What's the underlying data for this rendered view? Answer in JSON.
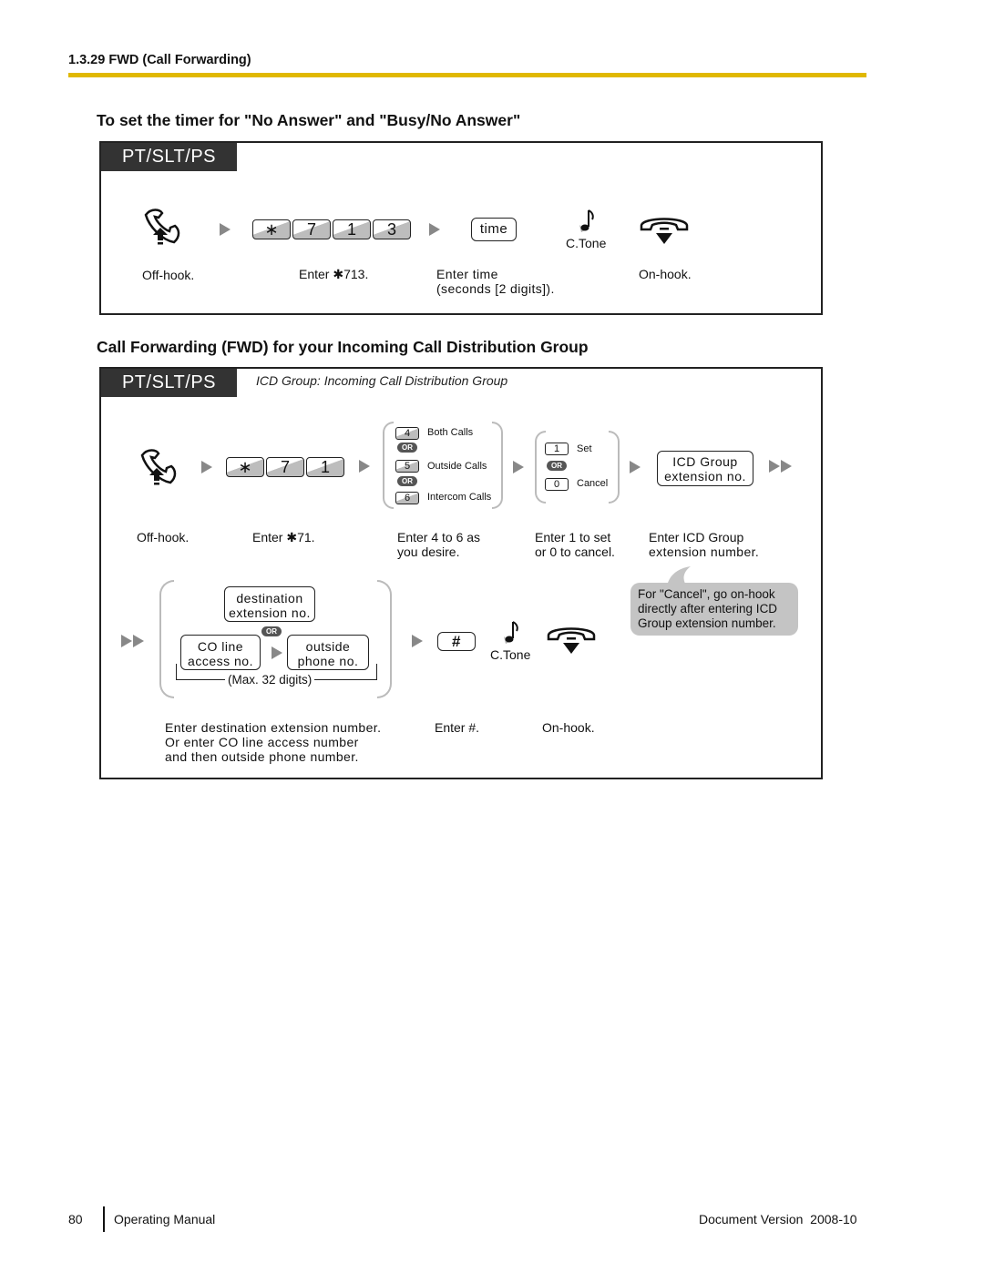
{
  "header": {
    "section": "1.3.29 FWD (Call Forwarding)"
  },
  "section1": {
    "title": "To set the timer for \"No Answer\" and \"Busy/No Answer\"",
    "tag": "PT/SLT/PS",
    "icons": {
      "offhook": "offhook-phone-icon",
      "onhook": "onhook-phone-icon",
      "tone": "confirmation-tone-icon",
      "arrow": "right-arrow-icon"
    },
    "keys": [
      "∗",
      "7",
      "1",
      "3"
    ],
    "time_box": "time",
    "tone_label": "C.Tone",
    "captions": {
      "offhook": "Off-hook.",
      "enter_code": "Enter ✱713.",
      "enter_time_1": "Enter time",
      "enter_time_2": "(seconds [2 digits]).",
      "onhook": "On-hook."
    }
  },
  "section2": {
    "title": "Call Forwarding (FWD) for your Incoming Call Distribution Group",
    "tag": "PT/SLT/PS",
    "note": "ICD Group: Incoming Call Distribution Group",
    "keys": [
      "∗",
      "7",
      "1"
    ],
    "call_type_options": [
      {
        "key": "4",
        "label": "Both Calls"
      },
      {
        "key": "5",
        "label": "Outside Calls"
      },
      {
        "key": "6",
        "label": "Intercom Calls"
      }
    ],
    "set_cancel_options": [
      {
        "key": "1",
        "label": "Set"
      },
      {
        "key": "0",
        "label": "Cancel"
      }
    ],
    "or_label": "OR",
    "icd_box": [
      "ICD Group",
      "extension no."
    ],
    "dest_box": [
      "destination",
      "extension no."
    ],
    "co_box": [
      "CO line",
      "access no."
    ],
    "outside_box": [
      "outside",
      "phone no."
    ],
    "max_digits": "(Max. 32 digits)",
    "hash_key": "#",
    "tone_label": "C.Tone",
    "bubble": [
      "For \"Cancel\", go on-hook",
      "directly after entering ICD",
      "Group extension number."
    ],
    "captions": {
      "offhook": "Off-hook.",
      "enter_code": "Enter ✱71.",
      "enter_46_1": "Enter 4 to 6 as",
      "enter_46_2": "you desire.",
      "enter_10_1": "Enter 1 to set",
      "enter_10_2": "or 0 to cancel.",
      "enter_icd_1": "Enter ICD Group",
      "enter_icd_2": "extension number.",
      "enter_dest_1": "Enter destination extension number.",
      "enter_dest_2": "Or enter CO line access number",
      "enter_dest_3": "and then outside phone number.",
      "enter_hash": "Enter #.",
      "onhook": "On-hook."
    }
  },
  "footer": {
    "page_number": "80",
    "manual": "Operating Manual",
    "version": "Document Version  2008-10"
  }
}
